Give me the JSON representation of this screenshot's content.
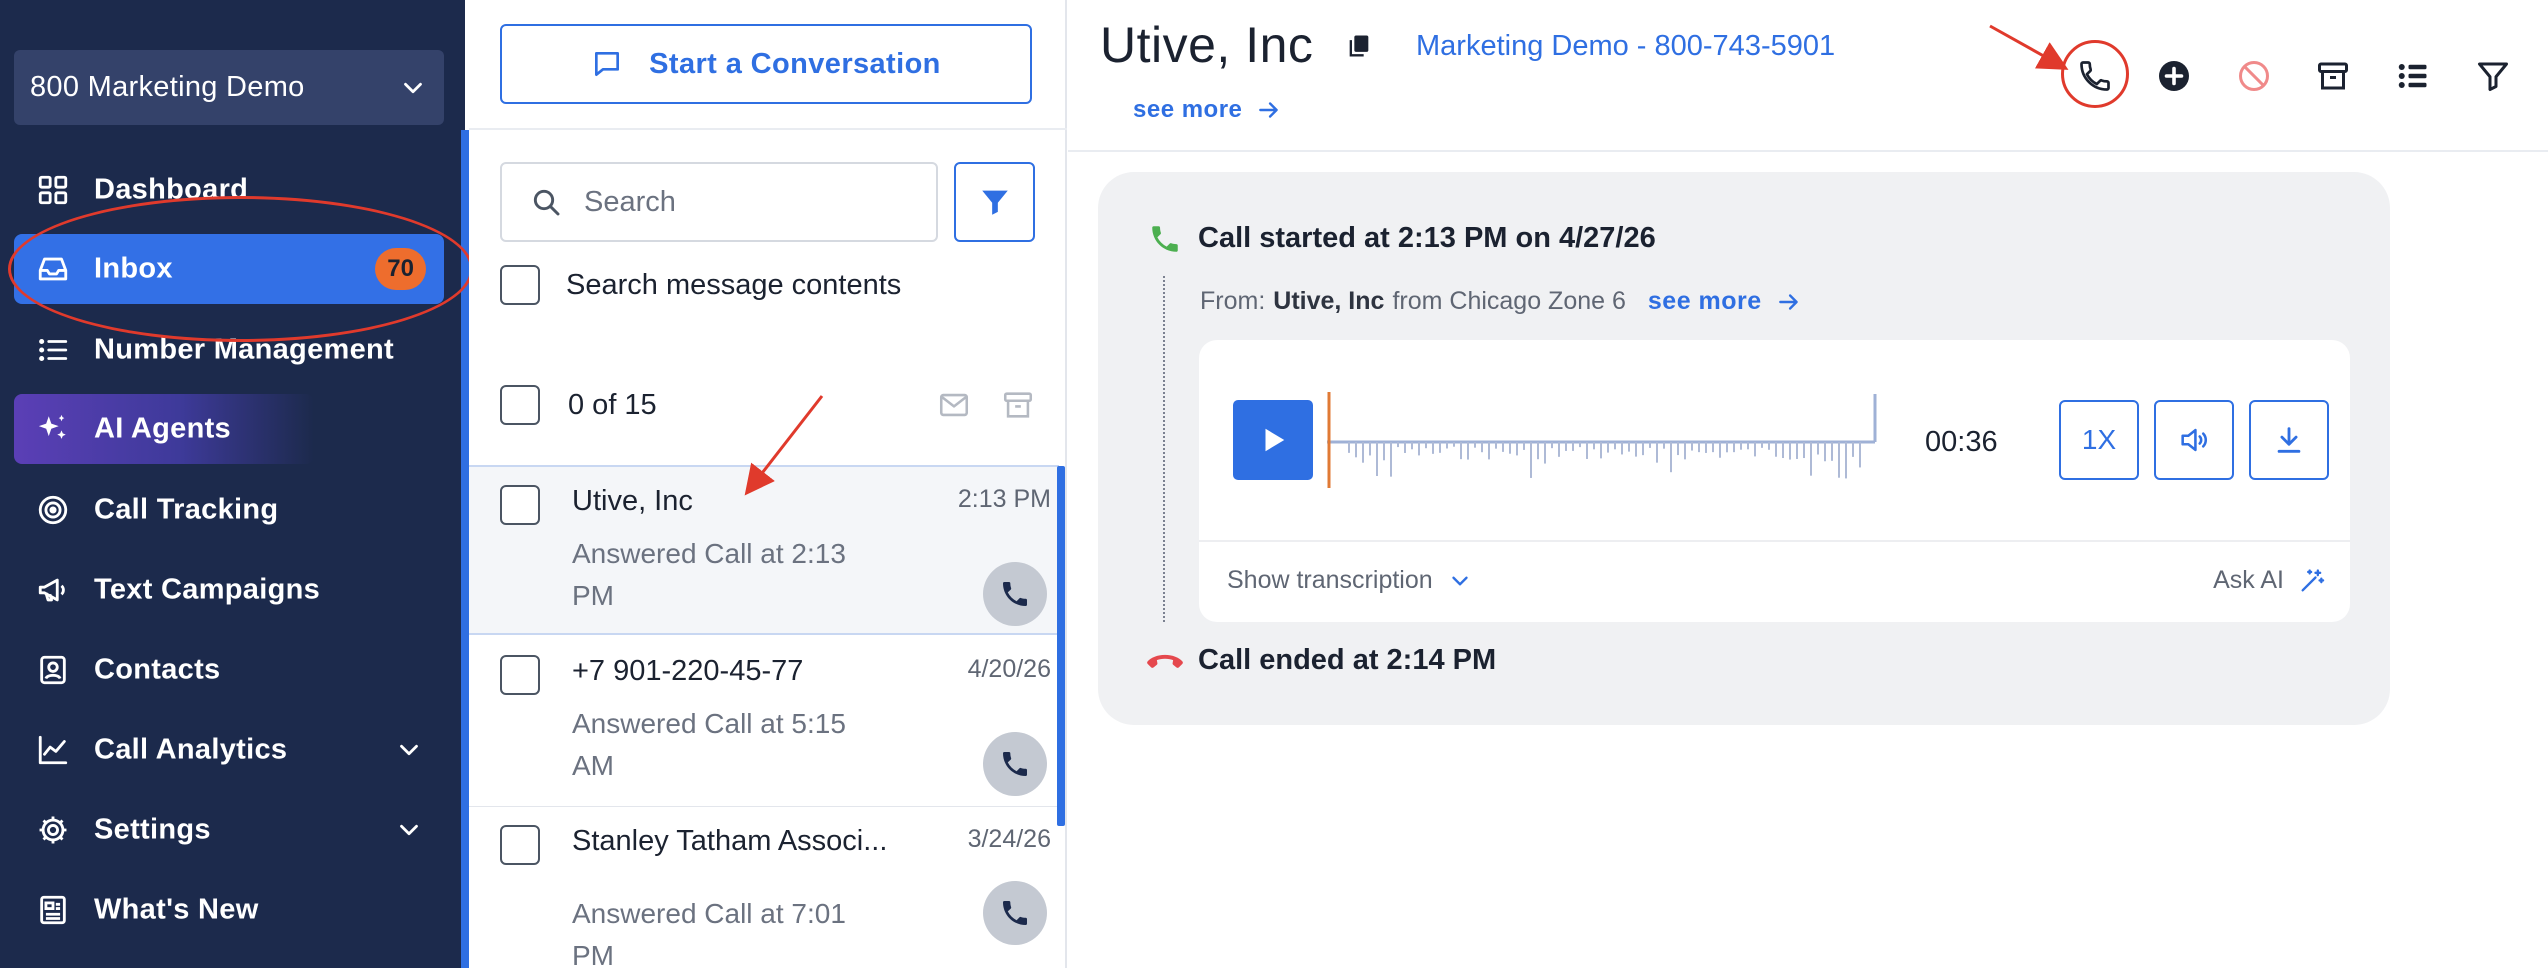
{
  "sidebar": {
    "account_name": "800 Marketing Demo",
    "items": [
      {
        "label": "Dashboard",
        "icon": "dashboard-icon"
      },
      {
        "label": "Inbox",
        "icon": "inbox-icon",
        "badge": "70"
      },
      {
        "label": "Number Management",
        "icon": "list-icon"
      },
      {
        "label": "AI Agents",
        "icon": "sparkles-icon"
      },
      {
        "label": "Call Tracking",
        "icon": "target-icon"
      },
      {
        "label": "Text Campaigns",
        "icon": "megaphone-icon"
      },
      {
        "label": "Contacts",
        "icon": "contact-card-icon"
      },
      {
        "label": "Call Analytics",
        "icon": "line-chart-icon"
      },
      {
        "label": "Settings",
        "icon": "gear-icon"
      },
      {
        "label": "What's New",
        "icon": "newspaper-icon"
      }
    ]
  },
  "list": {
    "start_label": "Start a Conversation",
    "search_placeholder": "Search",
    "search_contents_label": "Search message contents",
    "count_label": "0 of 15",
    "conversations": [
      {
        "name": "Utive, Inc",
        "time": "2:13 PM",
        "subtitle": "Answered Call at 2:13 PM"
      },
      {
        "name": "+7 901-220-45-77",
        "time": "4/20/26",
        "subtitle": "Answered Call at 5:15 AM"
      },
      {
        "name": "Stanley Tatham Associ...",
        "time": "3/24/26",
        "subtitle": "Answered Call at 7:01 PM"
      }
    ]
  },
  "main": {
    "contact_name": "Utive, Inc",
    "campaign_line": "Marketing Demo - 800-743-5901",
    "see_more": "see more",
    "header_icons": [
      "phone-icon",
      "plus-circle-icon",
      "block-icon",
      "archive-icon",
      "list-details-icon",
      "filter-icon"
    ],
    "call": {
      "started": "Call started at 2:13 PM on 4/27/26",
      "from_prefix": "From:",
      "from_name": "Utive, Inc",
      "from_suffix": "from Chicago Zone 6",
      "see_more": "see more",
      "duration": "00:36",
      "speed": "1X",
      "show_transcription": "Show transcription",
      "ask_ai": "Ask AI",
      "ended": "Call ended at 2:14 PM"
    }
  },
  "colors": {
    "sidebar_bg": "#1c2a4c",
    "accent": "#2f6fe2",
    "badge": "#ee6d2d",
    "annotation": "#e03a2c",
    "call_start_green": "#4caf50",
    "call_end_red": "#e5484d"
  }
}
